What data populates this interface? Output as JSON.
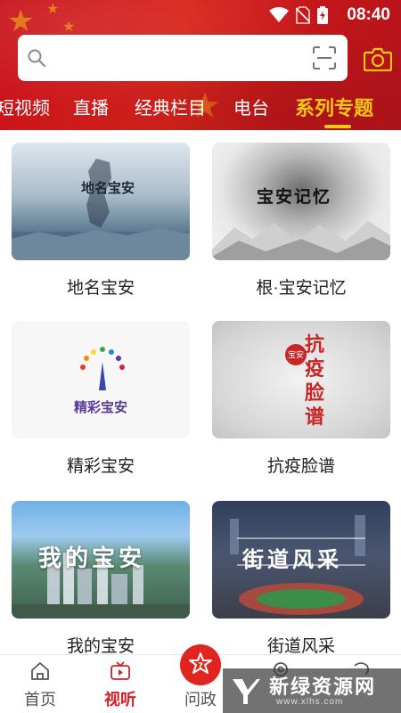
{
  "status_bar": {
    "time": "08:40"
  },
  "search": {
    "placeholder": ""
  },
  "tabs": [
    {
      "label": "短视频"
    },
    {
      "label": "直播"
    },
    {
      "label": "经典栏目"
    },
    {
      "label": "电台"
    },
    {
      "label": "系列专题"
    }
  ],
  "cards": [
    {
      "caption": "地名宝安",
      "thumb_text": "地名宝安"
    },
    {
      "caption": "根·宝安记忆",
      "thumb_text": "宝安记忆"
    },
    {
      "caption": "精彩宝安",
      "thumb_text": "精彩宝安"
    },
    {
      "caption": "抗疫脸谱",
      "thumb_text": "抗疫脸谱",
      "thumb_small": "宝安"
    },
    {
      "caption": "我的宝安",
      "thumb_text": "我的宝安"
    },
    {
      "caption": "街道风采",
      "thumb_text": "街道风采"
    }
  ],
  "bottom_nav": [
    {
      "label": "首页",
      "icon": "home-icon"
    },
    {
      "label": "视听",
      "icon": "tv-icon"
    },
    {
      "label": "问政",
      "icon": "question-icon"
    },
    {
      "label": "",
      "icon": "location-icon"
    },
    {
      "label": "",
      "icon": "user-icon"
    }
  ],
  "watermark": {
    "title": "新绿资源网",
    "sub": "www.xlhs.com"
  },
  "colors": {
    "brand_red": "#d0202a",
    "tab_active": "#f5c518"
  }
}
